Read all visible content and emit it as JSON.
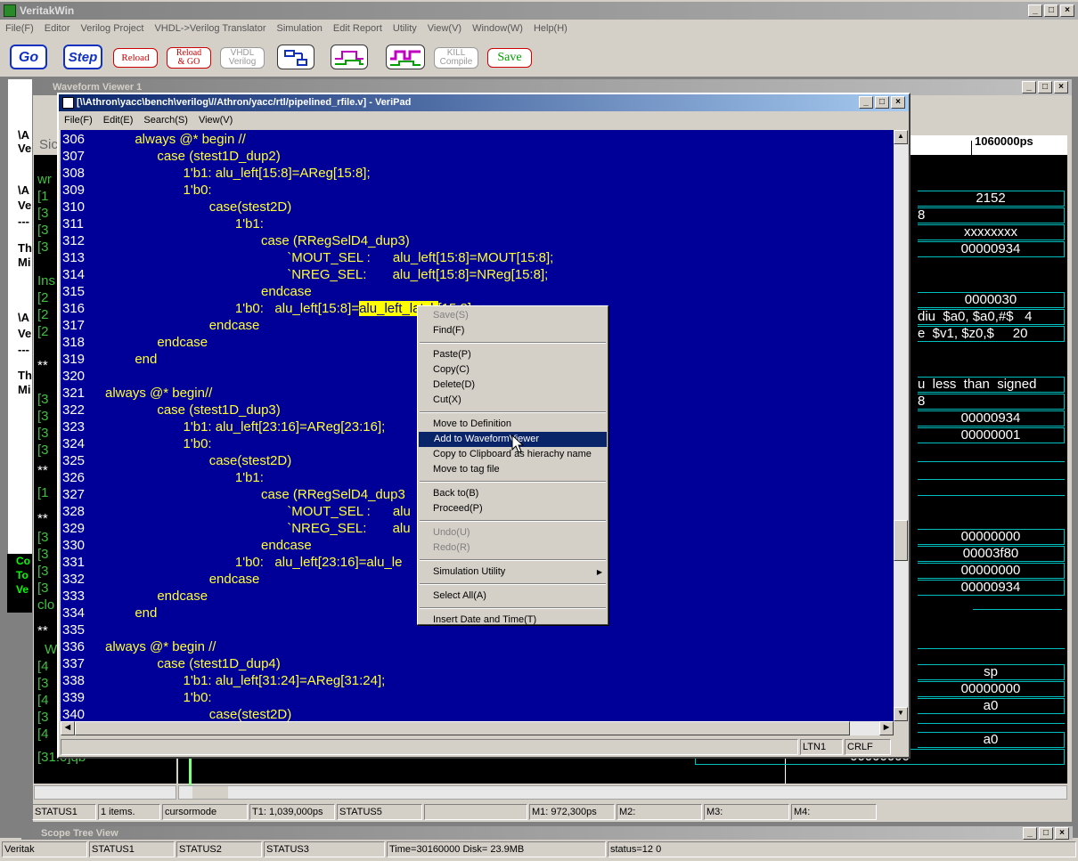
{
  "app": {
    "title": "VeritakWin",
    "menu": [
      "File(F)",
      "Editor",
      "Verilog Project",
      "VHDL->Verilog Translator",
      "Simulation",
      "Edit Report",
      "Utility",
      "View(V)",
      "Window(W)",
      "Help(H)"
    ]
  },
  "toolbar": {
    "go": "Go",
    "step": "Step",
    "reload": "Reload",
    "reload_go_1": "Reload",
    "reload_go_2": "& GO",
    "vhdl_1": "VHDL",
    "vhdl_2": "Verilog",
    "kill_1": "KILL",
    "kill_2": "Compile",
    "save": "Save"
  },
  "waveform_viewer": {
    "title": "Waveform Viewer 1",
    "time_label": "1060000ps",
    "values": [
      "2152",
      "8",
      "xxxxxxxx",
      "00000934",
      "0000030",
      "diu  $a0, $a0,#$   4",
      "e  $v1, $z0,$     20",
      "u  less  than  signed",
      "8",
      "00000934",
      "00000001",
      "00000000",
      "00003f80",
      "00000000",
      "00000934",
      "sp",
      "00000000",
      "a0",
      "a0",
      "00000000"
    ],
    "left_fragments": [
      "\\A",
      "Ve",
      "Sic",
      "wr",
      "[1",
      "\\A",
      "Ve",
      "[3",
      "---",
      "[3",
      "Th",
      "[3",
      "Mi",
      "Ins",
      "[2",
      "\\A",
      "[2",
      "Ve",
      "[2",
      "---",
      "**",
      "Th",
      "[3",
      "Mi",
      "[3",
      "[3",
      "[3",
      "**",
      "[1",
      "**",
      "[3",
      "[3",
      "[3",
      "[3",
      "clo",
      "**",
      "W",
      "[4",
      "[3",
      "[4",
      "[3",
      "[4",
      "[31:0]qb"
    ],
    "green_text": [
      "Co",
      "To",
      "Ve"
    ],
    "status": [
      "STATUS1",
      "1 items.",
      "cursormode",
      "T1: 1,039,000ps",
      "STATUS5",
      "",
      "M1: 972,300ps",
      "M2:",
      "M3:",
      "M4:"
    ]
  },
  "veripad": {
    "title": "[\\\\Athron\\yacc\\bench\\verilog\\//Athron/yacc/rtl/pipelined_rfile.v] - VeriPad",
    "menu": [
      "File(F)",
      "Edit(E)",
      "Search(S)",
      "View(V)"
    ],
    "lines": [
      {
        "n": "306",
        "t": "        always @* begin //"
      },
      {
        "n": "307",
        "t": "              case (stest1D_dup2)"
      },
      {
        "n": "308",
        "t": "                     1'b1: alu_left[15:8]=AReg[15:8];"
      },
      {
        "n": "309",
        "t": "                     1'b0:"
      },
      {
        "n": "310",
        "t": "                            case(stest2D)"
      },
      {
        "n": "311",
        "t": "                                   1'b1:"
      },
      {
        "n": "312",
        "t": "                                          case (RRegSelD4_dup3)"
      },
      {
        "n": "313",
        "t": "                                                 `MOUT_SEL :      alu_left[15:8]=MOUT[15:8];"
      },
      {
        "n": "314",
        "t": "                                                 `NREG_SEL:       alu_left[15:8]=NReg[15:8];"
      },
      {
        "n": "315",
        "t": "                                          endcase"
      },
      {
        "n": "316",
        "t": "                                   1'b0:   alu_left[15:8]=",
        "hl": "alu_left_latch",
        "after": "[15:8];"
      },
      {
        "n": "317",
        "t": "                            endcase"
      },
      {
        "n": "318",
        "t": "              endcase"
      },
      {
        "n": "319",
        "t": "        end"
      },
      {
        "n": "320",
        "t": ""
      },
      {
        "n": "321",
        "t": "always @* begin//"
      },
      {
        "n": "322",
        "t": "              case (stest1D_dup3)"
      },
      {
        "n": "323",
        "t": "                     1'b1: alu_left[23:16]=AReg[23:16];"
      },
      {
        "n": "324",
        "t": "                     1'b0:"
      },
      {
        "n": "325",
        "t": "                            case(stest2D)"
      },
      {
        "n": "326",
        "t": "                                   1'b1:"
      },
      {
        "n": "327",
        "t": "                                          case (RRegSelD4_dup3"
      },
      {
        "n": "328",
        "t": "                                                 `MOUT_SEL :      alu"
      },
      {
        "n": "329",
        "t": "                                                 `NREG_SEL:       alu"
      },
      {
        "n": "330",
        "t": "                                          endcase"
      },
      {
        "n": "331",
        "t": "                                   1'b0:   alu_left[23:16]=alu_le"
      },
      {
        "n": "332",
        "t": "                            endcase"
      },
      {
        "n": "333",
        "t": "              endcase"
      },
      {
        "n": "334",
        "t": "        end"
      },
      {
        "n": "335",
        "t": ""
      },
      {
        "n": "336",
        "t": "always @* begin //"
      },
      {
        "n": "337",
        "t": "              case (stest1D_dup4)"
      },
      {
        "n": "338",
        "t": "                     1'b1: alu_left[31:24]=AReg[31:24];"
      },
      {
        "n": "339",
        "t": "                     1'b0:"
      },
      {
        "n": "340",
        "t": "                            case(stest2D)"
      }
    ],
    "status": [
      "LTN1",
      "CRLF"
    ]
  },
  "context_menu": {
    "items": [
      "Save(S)",
      "Find(F)",
      "Paste(P)",
      "Copy(C)",
      "Delete(D)",
      "Cut(X)",
      "Move to Definition",
      "Add to WaveformViewer",
      "Copy to Clipboard as hierachy name",
      "Move to tag file",
      "Back to(B)",
      "Proceed(P)",
      "Undo(U)",
      "Redo(R)",
      "Simulation Utility",
      "Select All(A)",
      "Insert Date and Time(T)"
    ]
  },
  "scope_tree": {
    "title": "Scope Tree View"
  },
  "main_status": [
    "Veritak",
    "STATUS1",
    "STATUS2",
    "STATUS3",
    "Time=30160000 Disk= 23.9MB",
    "status=12 0"
  ],
  "colors": {
    "editor_bg": "#000099",
    "code": "#ffff33",
    "wave": "#00c0c0",
    "highlight": "#ffff00"
  }
}
